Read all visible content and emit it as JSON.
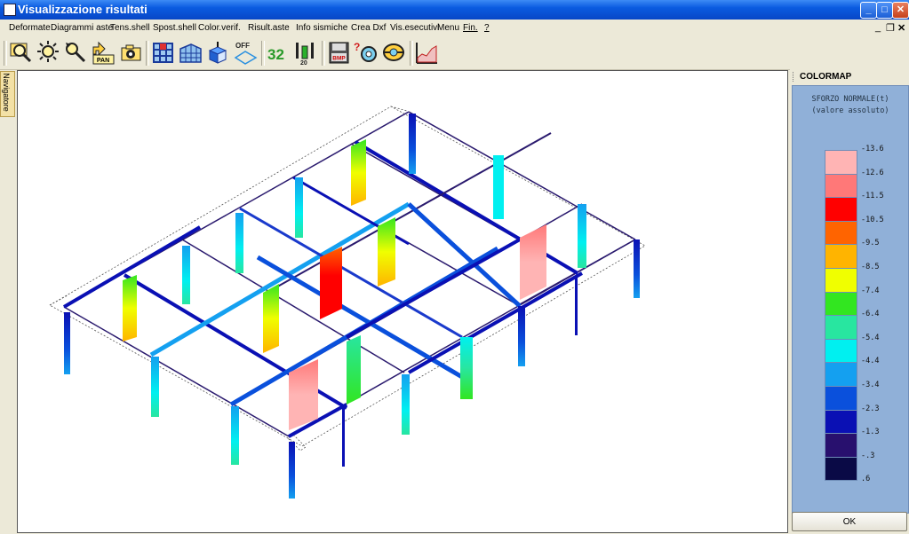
{
  "window": {
    "title": "Visualizzazione risultati"
  },
  "menu": [
    "Deformate",
    "Diagrammi aste",
    "Tens.shell",
    "Spost.shell",
    "Color.verif.",
    "Risult.aste",
    "Info sismiche",
    "Crea Dxf",
    "Vis.esecutivi",
    "Menu",
    "Fin.",
    "?"
  ],
  "toolbar": {
    "tools": [
      "zoom-window-icon",
      "zoom-all-icon",
      "zoom-pointer-icon",
      "pan-icon",
      "camera-icon",
      "building-front-icon",
      "building-3d-icon",
      "box-view-icon",
      "shading-off-icon",
      "numbering-icon",
      "scale-values-icon",
      "bmp-export-icon",
      "query-icon",
      "section-view-icon",
      "diagram-chart-icon"
    ],
    "pan_label": "PAN",
    "off_label": "OFF",
    "num_label": "32",
    "scale_label": "20",
    "bmp_label": "BMP"
  },
  "navigator": {
    "label": "Navigatore"
  },
  "colormap": {
    "header": "COLORMAP",
    "title_line1": "SFORZO NORMALE(t)",
    "title_line2": "(valore assoluto)",
    "levels": [
      "-13.6",
      "-12.6",
      "-11.5",
      "-10.5",
      "-9.5",
      "-8.5",
      "-7.4",
      "-6.4",
      "-5.4",
      "-4.4",
      "-3.4",
      "-2.3",
      "-1.3",
      "-.3",
      ".6"
    ],
    "colors": [
      "#ffb4b4",
      "#ff7878",
      "#ff0000",
      "#ff6400",
      "#ffb400",
      "#f0ff00",
      "#32e620",
      "#28e6a0",
      "#00f0f0",
      "#14a0f0",
      "#0a50dc",
      "#0a10b4",
      "#28106e",
      "#0a0a46"
    ],
    "ok_label": "OK"
  }
}
